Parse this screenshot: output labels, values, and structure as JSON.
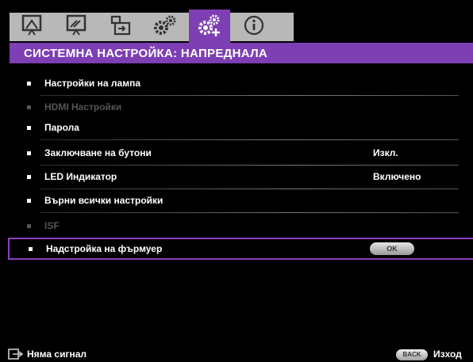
{
  "tabs": [
    {
      "icon": "projector-display-icon"
    },
    {
      "icon": "projector-picture-icon"
    },
    {
      "icon": "source-input-icon"
    },
    {
      "icon": "settings-basic-icon"
    },
    {
      "icon": "settings-advanced-icon",
      "active": true
    },
    {
      "icon": "info-icon"
    }
  ],
  "title": "СИСТЕМНА НАСТРОЙКА: НАПРЕДНАЛА",
  "accent_color": "#7d3fb3",
  "menu": [
    {
      "label": "Настройки на лампа",
      "value": "",
      "disabled": false
    },
    {
      "label": "HDMI Настройки",
      "value": "",
      "disabled": true
    },
    {
      "label": "Парола",
      "value": "",
      "disabled": false
    },
    {
      "label": "Заключване на бутони",
      "value": "Изкл.",
      "disabled": false
    },
    {
      "label": "LED Индикатор",
      "value": "Включено",
      "disabled": false
    },
    {
      "label": "Върни всички настройки",
      "value": "",
      "disabled": false
    },
    {
      "label": "ISF",
      "value": "",
      "disabled": true
    },
    {
      "label": "Надстройка на фърмуер",
      "button": "OK",
      "disabled": false,
      "selected": true
    }
  ],
  "footer": {
    "source_icon": "input-source-icon",
    "signal_text": "Няма сигнал",
    "back_label": "BACK",
    "exit_label": "Изход"
  }
}
